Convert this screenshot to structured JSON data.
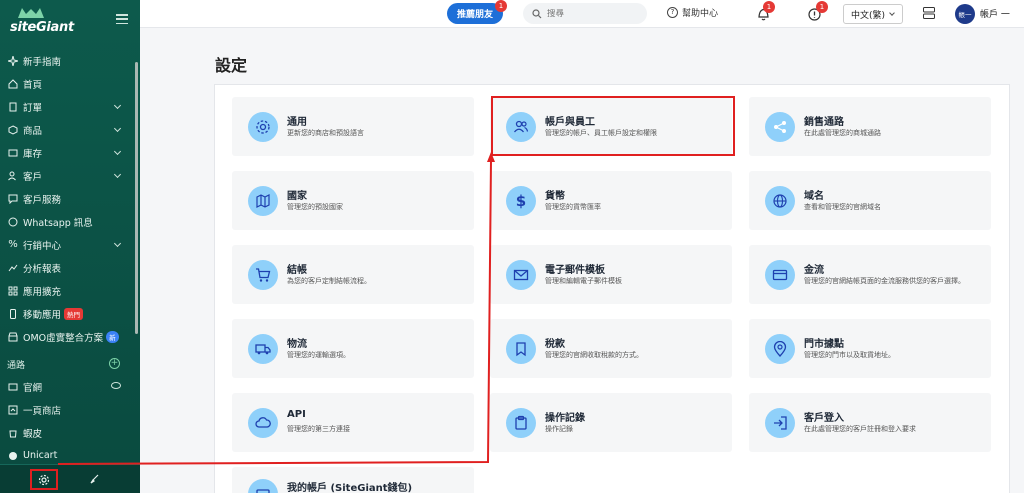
{
  "sidebar": {
    "logo": "siteGiant",
    "items": [
      {
        "label": "新手指南",
        "icon": "sparkle-icon",
        "chevron": false
      },
      {
        "label": "首頁",
        "icon": "home-icon",
        "chevron": false
      },
      {
        "label": "訂單",
        "icon": "document-icon",
        "chevron": true
      },
      {
        "label": "商品",
        "icon": "box-icon",
        "chevron": true
      },
      {
        "label": "庫存",
        "icon": "inventory-icon",
        "chevron": true
      },
      {
        "label": "客戶",
        "icon": "users-icon",
        "chevron": true
      },
      {
        "label": "客戶服務",
        "icon": "chat-icon",
        "chevron": false
      },
      {
        "label": "Whatsapp 訊息",
        "icon": "whatsapp-icon",
        "chevron": false
      },
      {
        "label": "行銷中心",
        "icon": "percent-icon",
        "chevron": true
      },
      {
        "label": "分析報表",
        "icon": "chart-icon",
        "chevron": false
      },
      {
        "label": "應用擴充",
        "icon": "grid-icon",
        "chevron": false
      },
      {
        "label": "移動應用",
        "icon": "phone-icon",
        "chevron": false,
        "badge": "熱門"
      },
      {
        "label": "OMO虛實整合方案",
        "icon": "store-icon",
        "chevron": false,
        "badge_new": "新"
      }
    ],
    "channels_label": "通路",
    "channels": [
      {
        "label": "官網",
        "icon": "website-icon"
      },
      {
        "label": "一頁商店",
        "icon": "page-icon"
      },
      {
        "label": "蝦皮",
        "icon": "shopee-icon"
      },
      {
        "label": "Unicart",
        "icon": "unicart-icon"
      }
    ]
  },
  "topbar": {
    "refer_label": "推薦朋友",
    "refer_count": "1",
    "search_placeholder": "搜尋",
    "help_label": "幫助中心",
    "bell_count": "1",
    "alert_count": "1",
    "language": "中文(繁)",
    "avatar_initials": "帳一",
    "account_name": "帳戶 一"
  },
  "page": {
    "title": "設定",
    "tiles": [
      {
        "title": "通用",
        "desc": "更新您的商店和預設語言",
        "icon": "gear-icon"
      },
      {
        "title": "帳戶與員工",
        "desc": "管理您的帳戶、員工帳戶設定和權限",
        "icon": "users-icon"
      },
      {
        "title": "銷售通路",
        "desc": "在此處管理您的商城通路",
        "icon": "share-icon"
      },
      {
        "title": "國家",
        "desc": "管理您的預設國家",
        "icon": "map-icon"
      },
      {
        "title": "貨幣",
        "desc": "管理您的貨幣匯率",
        "icon": "dollar-icon"
      },
      {
        "title": "域名",
        "desc": "查看和管理您的官網域名",
        "icon": "globe-icon"
      },
      {
        "title": "結帳",
        "desc": "為您的客戶定制結帳流程。",
        "icon": "cart-icon"
      },
      {
        "title": "電子郵件模板",
        "desc": "管理和編輯電子郵件模板",
        "icon": "mail-icon"
      },
      {
        "title": "金流",
        "desc": "管理您的官網結帳頁面的金流服務供您的客戶選擇。",
        "icon": "credit-card-icon"
      },
      {
        "title": "物流",
        "desc": "管理您的運輸選項。",
        "icon": "truck-icon"
      },
      {
        "title": "稅款",
        "desc": "管理您的官網收取稅款的方式。",
        "icon": "bookmark-icon"
      },
      {
        "title": "門市據點",
        "desc": "管理您的門市以及取貨地址。",
        "icon": "location-icon"
      },
      {
        "title": "API",
        "desc": "管理您的第三方連接",
        "icon": "cloud-icon"
      },
      {
        "title": "操作記錄",
        "desc": "操作記錄",
        "icon": "clipboard-icon"
      },
      {
        "title": "客戶登入",
        "desc": "在此處管理您的客戶註冊和登入要求",
        "icon": "login-icon"
      },
      {
        "title": "我的帳戶 (SiteGiant錢包)",
        "desc": "",
        "icon": "wallet-icon"
      }
    ]
  },
  "colors": {
    "sidebar_bg": "#0d5a4c",
    "accent_blue": "#1d6fd8",
    "icon_circle": "#8fd0fa",
    "highlight_red": "#e02020"
  }
}
